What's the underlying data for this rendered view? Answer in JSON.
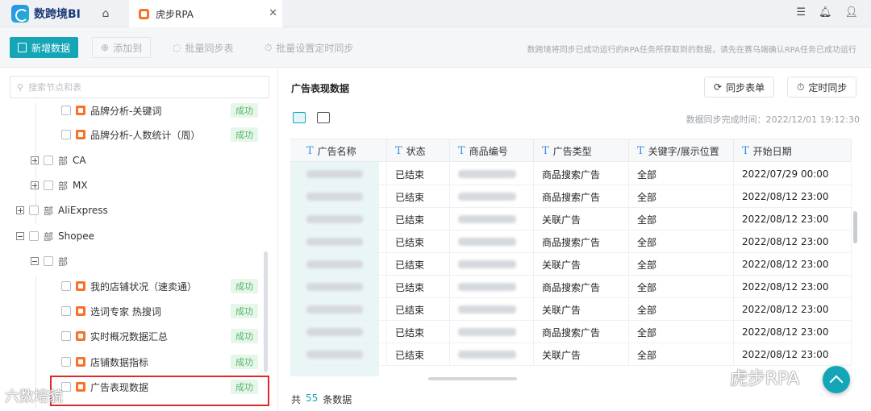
{
  "app": {
    "logo_text": "数跨境BI"
  },
  "tabs": {
    "rpa_label": "虎步RPA",
    "close_glyph": "✕"
  },
  "toolbar": {
    "new_label": "新增数据",
    "add_to_label": "添加到",
    "batch_sync_label": "批量同步表",
    "batch_schedule_label": "批量设置定时同步",
    "note": "数跨境将同步已成功运行的RPA任务所获取到的数据，请先在赛乌端确认RPA任务已成功运行"
  },
  "search": {
    "placeholder": "搜索节点和表"
  },
  "tree": {
    "top_partial": {
      "label": "品牌分析-关键词",
      "status": "成功"
    },
    "brand_weekly": {
      "label": "品牌分析-人数统计（周）",
      "status": "成功"
    },
    "ca": "CA",
    "mx": "MX",
    "aliexpress": "AliExpress",
    "shopee": "Shopee",
    "shopee_child_folder": "",
    "folder_glyph": "部",
    "leaves": [
      {
        "label": "我的店铺状况（速卖通）",
        "status": "成功"
      },
      {
        "label": "选词专家 热搜词",
        "status": "成功"
      },
      {
        "label": "实时概况数据汇总",
        "status": "成功"
      },
      {
        "label": "店铺数据指标",
        "status": "成功"
      },
      {
        "label": "广告表现数据",
        "status": "成功"
      }
    ]
  },
  "panel": {
    "title": "广告表现数据",
    "sync_table_label": "同步表单",
    "scheduled_sync_label": "定时同步",
    "sync_time": "数据同步完成时间：2022/12/01 19:12:30"
  },
  "table": {
    "type_glyph": "T",
    "columns": [
      "广告名称",
      "状态",
      "商品编号",
      "广告类型",
      "关键字/展示位置",
      "开始日期"
    ],
    "rows": [
      [
        "",
        "已结束",
        "",
        "商品搜索广告",
        "全部",
        "2022/07/29 00:00"
      ],
      [
        "",
        "已结束",
        "",
        "商品搜索广告",
        "全部",
        "2022/08/12 23:00"
      ],
      [
        "",
        "已结束",
        "",
        "关联广告",
        "全部",
        "2022/08/12 23:00"
      ],
      [
        "",
        "已结束",
        "",
        "商品搜索广告",
        "全部",
        "2022/08/12 23:00"
      ],
      [
        "",
        "已结束",
        "",
        "关联广告",
        "全部",
        "2022/08/12 23:00"
      ],
      [
        "",
        "已结束",
        "",
        "商品搜索广告",
        "全部",
        "2022/08/12 23:00"
      ],
      [
        "",
        "已结束",
        "",
        "关联广告",
        "全部",
        "2022/08/12 23:00"
      ],
      [
        "",
        "已结束",
        "",
        "商品搜索广告",
        "全部",
        "2022/08/12 23:00"
      ],
      [
        "",
        "已结束",
        "",
        "关联广告",
        "全部",
        "2022/08/12 23:00"
      ]
    ]
  },
  "footer": {
    "prefix": "共",
    "count": "55",
    "suffix": "条数据"
  },
  "watermarks": {
    "left": "六数培貌",
    "right": "虎步RPA"
  },
  "colors": {
    "accent": "#14a6b7",
    "success_bg": "#e7f6ea",
    "success_text": "#52b86a",
    "highlight": "#e02a2a",
    "rpa_orange": "#f5732a"
  }
}
